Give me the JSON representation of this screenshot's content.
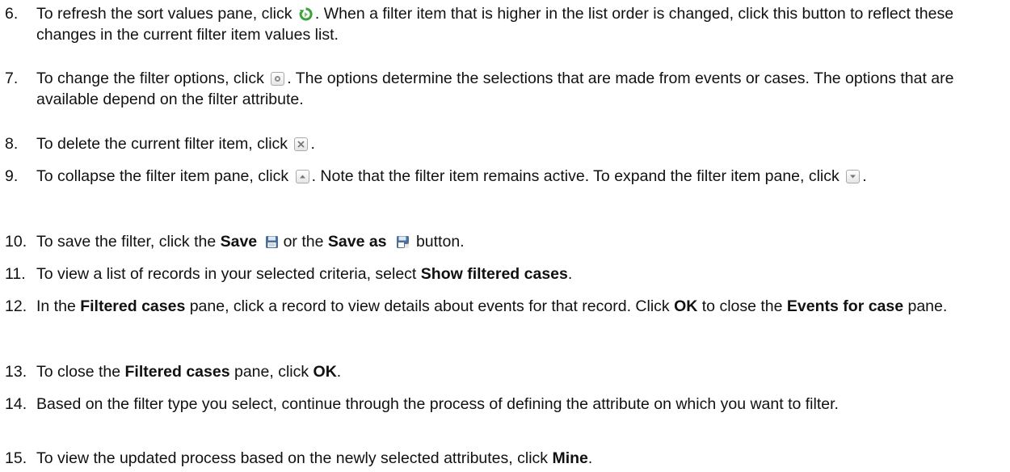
{
  "steps": [
    {
      "number": "6.",
      "parts": [
        "To refresh the sort values pane, click ",
        ". When a filter item that is higher in the list order is changed, click this button to reflect these changes in the current filter item values list."
      ],
      "icon": "refresh-icon"
    },
    {
      "number": "7.",
      "parts": [
        "To change the filter options, click ",
        ". The options determine the selections that are made from events or cases. The options that are available depend on the filter attribute."
      ],
      "icon": "options-icon"
    },
    {
      "number": "8.",
      "parts": [
        "To delete the current filter item, click ",
        "."
      ],
      "icon": "delete-icon"
    },
    {
      "number": "9.",
      "parts": [
        "To collapse the filter item pane, click ",
        ". Note that the filter item remains active. To expand the filter item pane, click ",
        "."
      ],
      "icons": [
        "collapse-icon",
        "expand-icon"
      ]
    },
    {
      "number": "10.",
      "parts": [
        "To save the filter, click the ",
        "Save",
        "or the ",
        "Save as",
        "button."
      ],
      "icons": [
        "save-icon",
        "save-as-icon"
      ]
    },
    {
      "number": "11.",
      "parts": [
        "To view a list of records in your selected criteria, select ",
        "Show filtered cases",
        "."
      ]
    },
    {
      "number": "12.",
      "parts": [
        "In the ",
        "Filtered cases",
        " pane, click a record to view details about events for that record. Click ",
        "OK",
        " to close the ",
        "Events for case",
        " pane."
      ]
    },
    {
      "number": "13.",
      "parts": [
        "To close the ",
        "Filtered cases",
        " pane, click ",
        "OK",
        "."
      ]
    },
    {
      "number": "14.",
      "parts": [
        "Based on the filter type you select, continue through the process of defining the attribute on which you want to filter."
      ]
    },
    {
      "number": "15.",
      "parts": [
        "To view the updated process based on the newly selected attributes, click ",
        "Mine",
        "."
      ]
    }
  ]
}
